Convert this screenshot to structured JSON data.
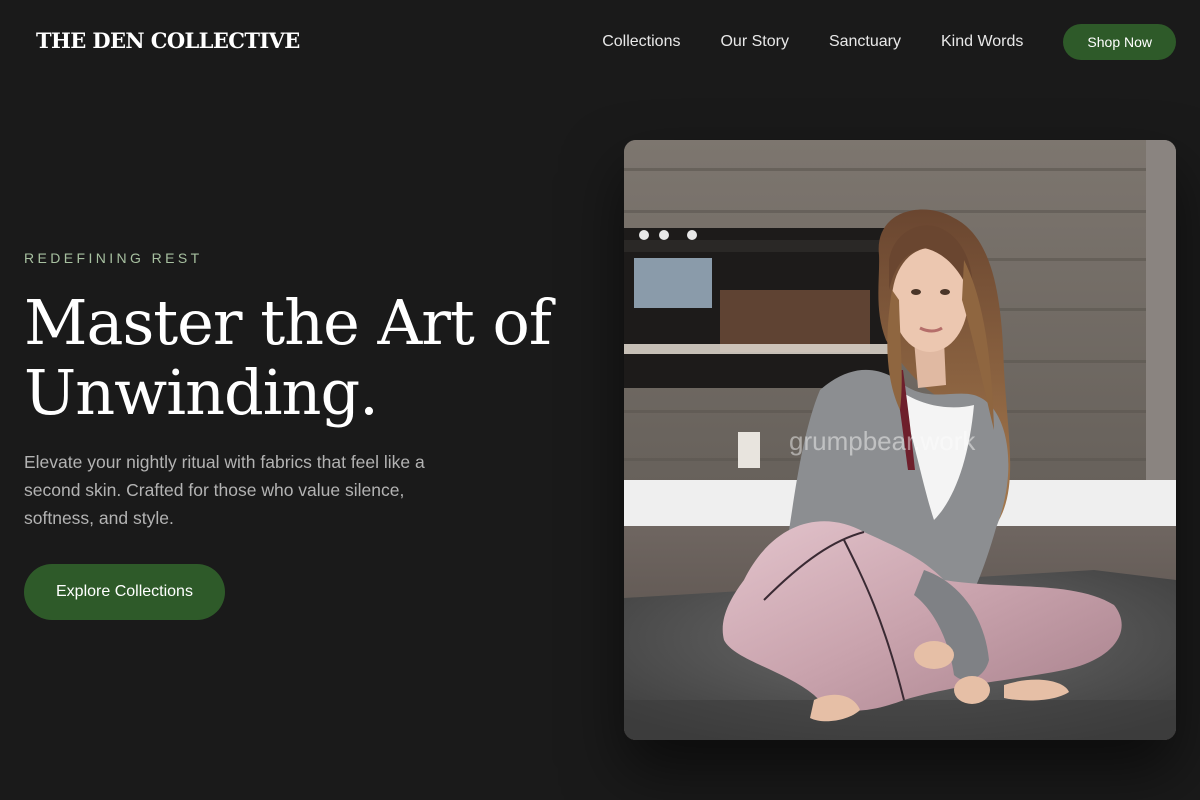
{
  "brand": {
    "logo_text": "THE DEN COLLECTIVE"
  },
  "nav": {
    "links": [
      {
        "label": "Collections"
      },
      {
        "label": "Our Story"
      },
      {
        "label": "Sanctuary"
      },
      {
        "label": "Kind Words"
      }
    ],
    "cta_label": "Shop Now"
  },
  "hero": {
    "eyebrow": "REDEFINING REST",
    "headline_line1": "Master the Art of",
    "headline_line2": "Unwinding.",
    "subtext": "Elevate your nightly ritual with fabrics that feel like a second skin. Crafted for those who value silence, softness, and style.",
    "cta_label": "Explore Collections",
    "image": {
      "description": "woman in grey cardigan and pink satin pajama pants sitting cross-legged on a grey rug in front of a fireplace",
      "watermark": "grumpbear.work"
    }
  },
  "colors": {
    "background": "#1a1a1a",
    "accent_green": "#2e5a29",
    "eyebrow_green": "#a7c0a0",
    "body_text": "#b3b3b3"
  }
}
